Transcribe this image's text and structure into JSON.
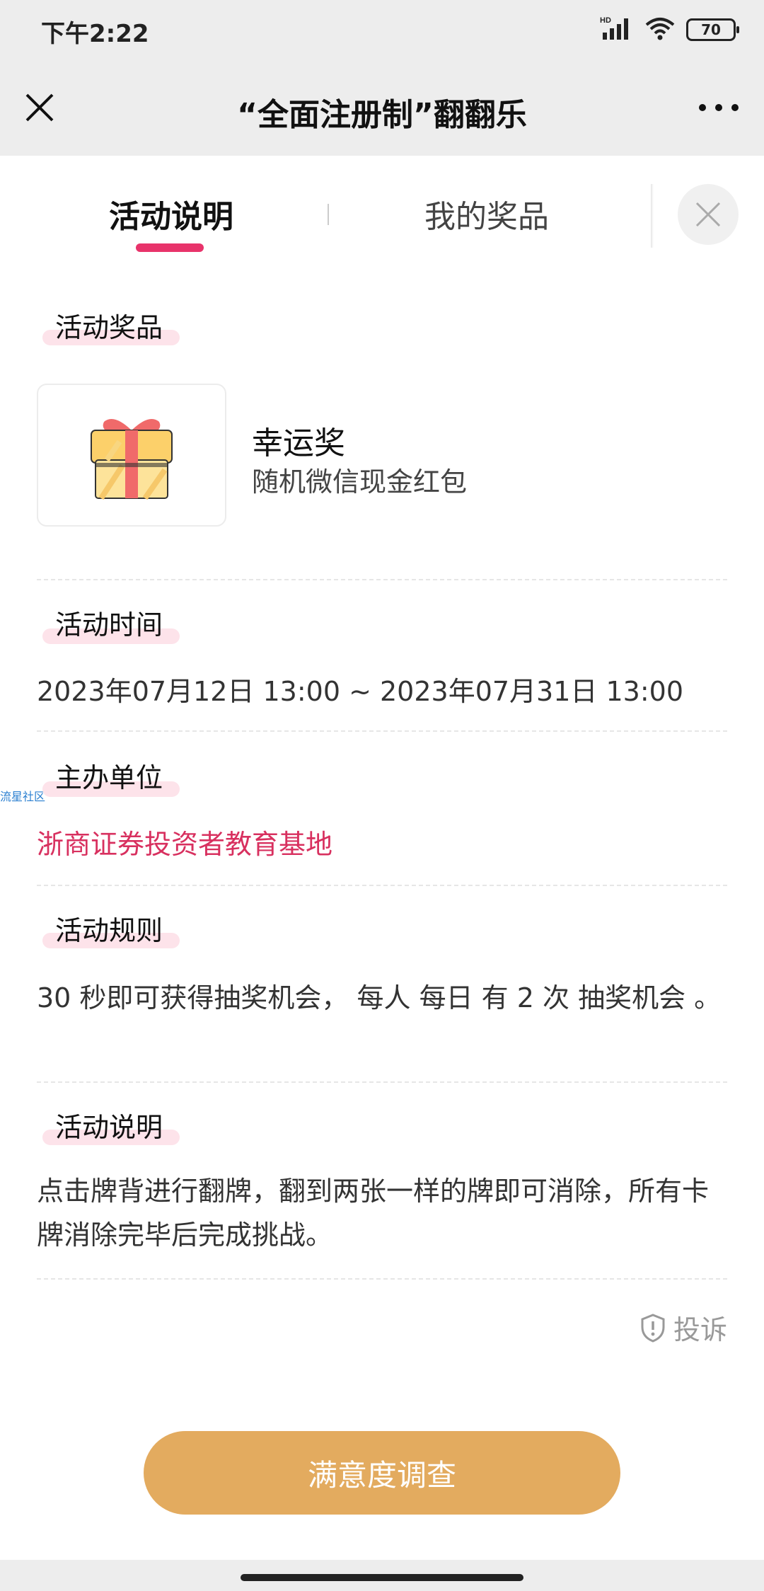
{
  "status_bar": {
    "time": "下午2:22",
    "network_badge": "HD",
    "battery": "70",
    "icons": [
      "signal-icon",
      "wifi-icon",
      "battery-icon"
    ]
  },
  "title_bar": {
    "title": "“全面注册制”翻翻乐",
    "close_icon": "close-icon",
    "more_icon": "more-icon"
  },
  "tabs": {
    "items": [
      {
        "label": "活动说明",
        "active": true
      },
      {
        "label": "我的奖品",
        "active": false
      }
    ],
    "accent_color": "#e8336b"
  },
  "sections": {
    "prize": {
      "label": "活动奖品",
      "name": "幸运奖",
      "desc": "随机微信现金红包",
      "icon": "gift-icon"
    },
    "time": {
      "label": "活动时间",
      "value": "2023年07月12日 13:00 ~ 2023年07月31日 13:00"
    },
    "organizer": {
      "label": "主办单位",
      "value": "浙商证券投资者教育基地",
      "color": "#d8305f"
    },
    "rules": {
      "label": "活动规则",
      "value": "30 秒即可获得抽奖机会， 每人 每日 有 2 次 抽奖机会 。"
    },
    "description": {
      "label": "活动说明",
      "value": "点击牌背进行翻牌，翻到两张一样的牌即可消除，所有卡牌消除完毕后完成挑战。"
    }
  },
  "watermark": "流星社区",
  "complain": {
    "label": "投诉",
    "icon": "shield-alert-icon"
  },
  "survey_button": {
    "label": "满意度调查",
    "color": "#e3ab5f"
  }
}
